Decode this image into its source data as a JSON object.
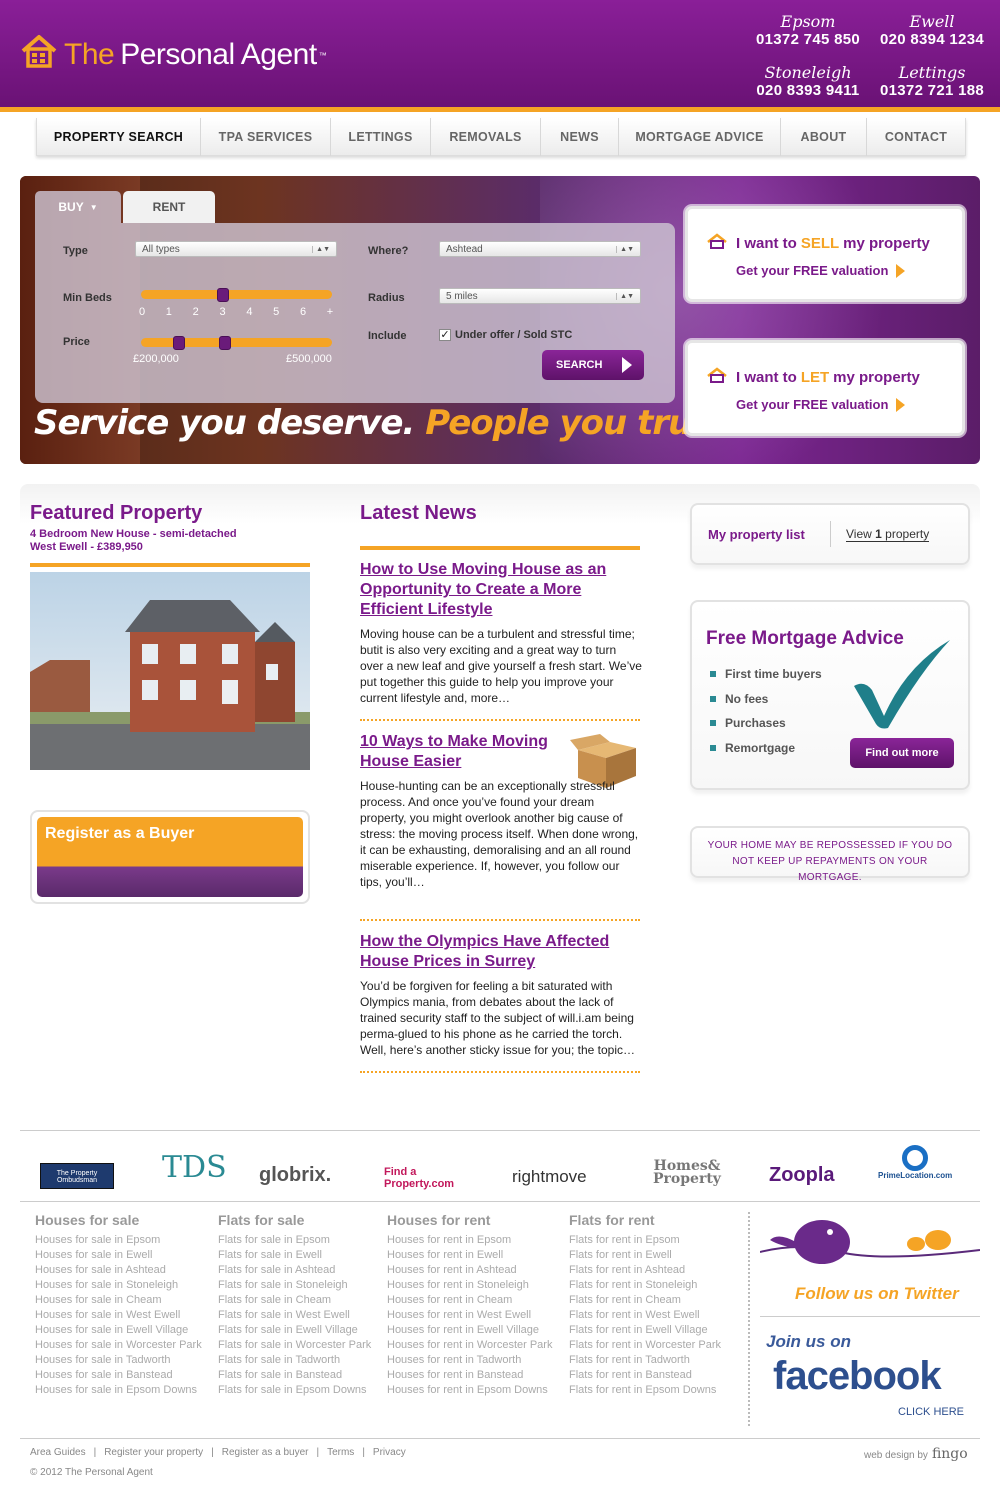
{
  "header": {
    "brand_the": "The",
    "brand_rest": "Personal Agent",
    "brand_tm": "™",
    "offices": [
      {
        "name": "Epsom",
        "phone": "01372 745 850"
      },
      {
        "name": "Ewell",
        "phone": "020 8394 1234"
      },
      {
        "name": "Stoneleigh",
        "phone": "020 8393 9411"
      },
      {
        "name": "Lettings",
        "phone": "01372 721 188"
      }
    ]
  },
  "nav": [
    "PROPERTY SEARCH",
    "TPA SERVICES",
    "LETTINGS",
    "REMOVALS",
    "NEWS",
    "MORTGAGE ADVICE",
    "ABOUT",
    "CONTACT"
  ],
  "search": {
    "tab_buy": "BUY",
    "tab_rent": "RENT",
    "type_label": "Type",
    "type_value": "All types",
    "where_label": "Where?",
    "where_value": "Ashtead",
    "beds_label": "Min Beds",
    "beds_ticks": [
      "0",
      "1",
      "2",
      "3",
      "4",
      "5",
      "6",
      "+"
    ],
    "beds_value": 3,
    "radius_label": "Radius",
    "radius_value": "5 miles",
    "price_label": "Price",
    "price_min": "£200,000",
    "price_max": "£500,000",
    "include_label": "Include",
    "include_option": "Under offer / Sold STC",
    "include_checked": true,
    "search_button": "SEARCH"
  },
  "slogan": {
    "white": "Service you deserve.",
    "orange": "People you trust."
  },
  "cta_sell": {
    "pre": "I want to",
    "highlight": "SELL",
    "post": "my property",
    "sub": "Get your FREE valuation"
  },
  "cta_let": {
    "pre": "I want to",
    "highlight": "LET",
    "post": "my property",
    "sub": "Get your FREE valuation"
  },
  "featured": {
    "heading": "Featured Property",
    "line1": "4 Bedroom New House - semi-detached",
    "line2": "West Ewell - £389,950",
    "register_label": "Register as a Buyer"
  },
  "news": {
    "heading": "Latest News",
    "items": [
      {
        "title": "How to Use Moving House as an Opportunity to Create a More Efficient Lifestyle",
        "body": "Moving house can be a turbulent and stressful time; butit is also very exciting and a great way to turn over a new leaf and give yourself a fresh start. We’ve put together this guide to help you improve your current lifestyle and, more…"
      },
      {
        "title": "10 Ways to Make Moving House Easier",
        "body": "House-hunting can be an exceptionally stressful process. And once you’ve found your dream property, you might overlook another big cause of stress: the moving process itself. When done wrong, it can be exhausting, demoralising and an all round miserable experience. If, however, you follow our tips, you’ll…"
      },
      {
        "title": "How the Olympics Have Affected House Prices in Surrey",
        "body": "You’d be forgiven for feeling a bit saturated with Olympics mania, from debates about the lack of trained security staff to the subject of will.i.am being perma-glued to his phone as he carried the torch. Well, here’s another sticky issue for you; the topic…"
      }
    ]
  },
  "property_list": {
    "label": "My property list",
    "view_pre": "View",
    "view_count": "1",
    "view_post": "property"
  },
  "mortgage": {
    "heading": "Free Mortgage Advice",
    "items": [
      "First time buyers",
      "No fees",
      "Purchases",
      "Remortgage"
    ],
    "button": "Find out more"
  },
  "warning": "YOUR HOME MAY BE REPOSSESSED IF YOU DO NOT KEEP UP REPAYMENTS ON YOUR MORTGAGE.",
  "partners": [
    "The Property Ombudsman",
    "TDS",
    "globrix.",
    "Find a Property.com",
    "rightmove",
    "Homes& Property",
    "Zoopla",
    "PrimeLocation.com"
  ],
  "footer_cols": [
    {
      "heading": "Houses for sale",
      "links": [
        "Houses for sale in Epsom",
        "Houses for sale in Ewell",
        "Houses for sale in Ashtead",
        "Houses for sale in Stoneleigh",
        "Houses for sale in Cheam",
        "Houses for sale in West Ewell",
        "Houses for sale in Ewell Village",
        "Houses for sale in Worcester Park",
        "Houses for sale in Tadworth",
        "Houses for sale in Banstead",
        "Houses for sale in Epsom Downs"
      ]
    },
    {
      "heading": "Flats for sale",
      "links": [
        "Flats for sale in Epsom",
        "Flats for sale in Ewell",
        "Flats for sale in Ashtead",
        "Flats for sale in Stoneleigh",
        "Flats for sale in Cheam",
        "Flats for sale in West Ewell",
        "Flats for sale in Ewell Village",
        "Flats for sale in Worcester Park",
        "Flats for sale in Tadworth",
        "Flats for sale in Banstead",
        "Flats for sale in Epsom Downs"
      ]
    },
    {
      "heading": "Houses for rent",
      "links": [
        "Houses for rent in Epsom",
        "Houses for rent in Ewell",
        "Houses for rent in Ashtead",
        "Houses for rent in Stoneleigh",
        "Houses for rent in Cheam",
        "Houses for rent in West Ewell",
        "Houses for rent in Ewell Village",
        "Houses for rent in Worcester Park",
        "Houses for rent in Tadworth",
        "Houses for rent in Banstead",
        "Houses for rent in Epsom Downs"
      ]
    },
    {
      "heading": "Flats for rent",
      "links": [
        "Flats for rent in Epsom",
        "Flats for rent in Ewell",
        "Flats for rent in Ashtead",
        "Flats for rent in Stoneleigh",
        "Flats for rent in Cheam",
        "Flats for rent in West Ewell",
        "Flats for rent in Ewell Village",
        "Flats for rent in Worcester Park",
        "Flats for rent in Tadworth",
        "Flats for rent in Banstead",
        "Flats for rent in Epsom Downs"
      ]
    }
  ],
  "social": {
    "twitter": "Follow us on Twitter",
    "fb_join": "Join us on",
    "fb_name": "facebook",
    "fb_click": "CLICK HERE"
  },
  "bottom_links": [
    "Area Guides",
    "Register your property",
    "Register as a buyer",
    "Terms",
    "Privacy"
  ],
  "copyright": "© 2012 The Personal Agent",
  "credit_pre": "web design by",
  "credit_name": "fingo",
  "colors": {
    "purple": "#7a1a8a",
    "orange": "#f5a425",
    "teal": "#2a8a93"
  }
}
